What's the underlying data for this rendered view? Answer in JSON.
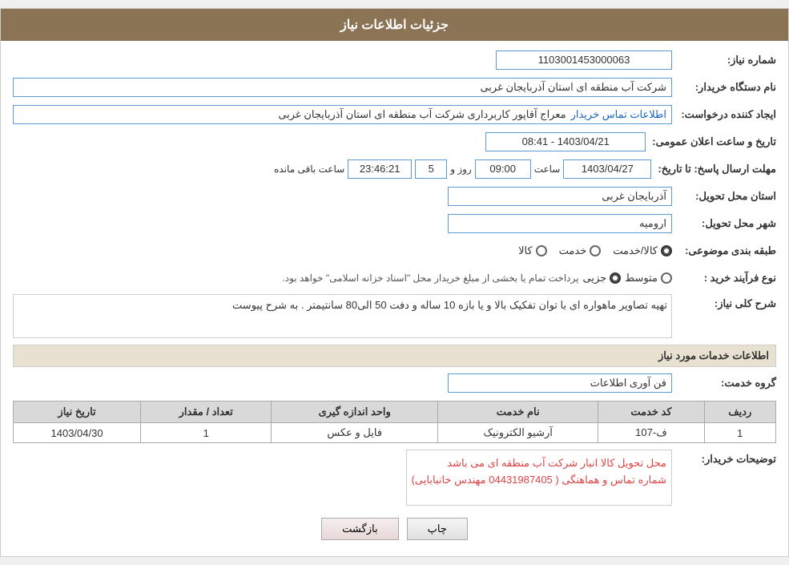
{
  "page": {
    "title": "جزئیات اطلاعات نیاز",
    "fields": {
      "need_number_label": "شماره نیاز:",
      "need_number_value": "1103001453000063",
      "buyer_label": "نام دستگاه خریدار:",
      "buyer_value": "شرکت آب منطقه ای استان آذربایجان غربی",
      "creator_label": "ایجاد کننده درخواست:",
      "creator_value": "معراج آقاپور کاربردارى شرکت آب منطقه ای استان آذربایجان غربی",
      "creator_link": "اطلاعات تماس خریدار",
      "announce_datetime_label": "تاریخ و ساعت اعلان عمومی:",
      "announce_datetime_value": "1403/04/21 - 08:41",
      "response_deadline_label": "مهلت ارسال پاسخ: تا تاریخ:",
      "response_date": "1403/04/27",
      "response_time_label": "ساعت",
      "response_time": "09:00",
      "response_day_label": "روز و",
      "response_days": "5",
      "response_remaining_label": "ساعت باقی مانده",
      "response_remaining": "23:46:21",
      "delivery_province_label": "استان محل تحویل:",
      "delivery_province_value": "آذربایجان غربی",
      "delivery_city_label": "شهر محل تحویل:",
      "delivery_city_value": "ارومیه",
      "category_label": "طبقه بندی موضوعی:",
      "category_kala": "کالا",
      "category_khadamat": "خدمت",
      "category_kala_khadamat": "کالا/خدمت",
      "category_selected": "کالا/خدمت",
      "process_label": "نوع فرآیند خرید :",
      "process_jozvi": "جزیی",
      "process_mottavaset": "متوسط",
      "process_desc": "پرداخت تمام یا بخشی از مبلغ خریدار محل \"اسناد خزانه اسلامی\" خواهد بود.",
      "description_label": "شرح کلی نیاز:",
      "description_value": "تهیه تصاویر ماهواره ای با توان تفکیک بالا و یا بازه 10 ساله و دفت 50 الی80 سانتیمتر . به شرح پیوست",
      "services_section": "اطلاعات خدمات مورد نیاز",
      "service_group_label": "گروه خدمت:",
      "service_group_value": "فن آوری اطلاعات",
      "table": {
        "headers": [
          "ردیف",
          "کد خدمت",
          "نام خدمت",
          "واحد اندازه گیری",
          "تعداد / مقدار",
          "تاریخ نیاز"
        ],
        "rows": [
          {
            "row": "1",
            "service_code": "ف-107",
            "service_name": "آرشیو الکترونیک",
            "unit": "فایل و عکس",
            "quantity": "1",
            "date": "1403/04/30"
          }
        ]
      },
      "buyer_desc_label": "توضیحات خریدار:",
      "buyer_desc_line1": "محل تحویل کالا انبار شرکت آب منطقه ای می باشد",
      "buyer_desc_line2": "شماره تماس و هماهنگی ( 04431987405 مهندس خانبابایی)"
    },
    "buttons": {
      "print": "چاپ",
      "back": "بازگشت"
    }
  }
}
